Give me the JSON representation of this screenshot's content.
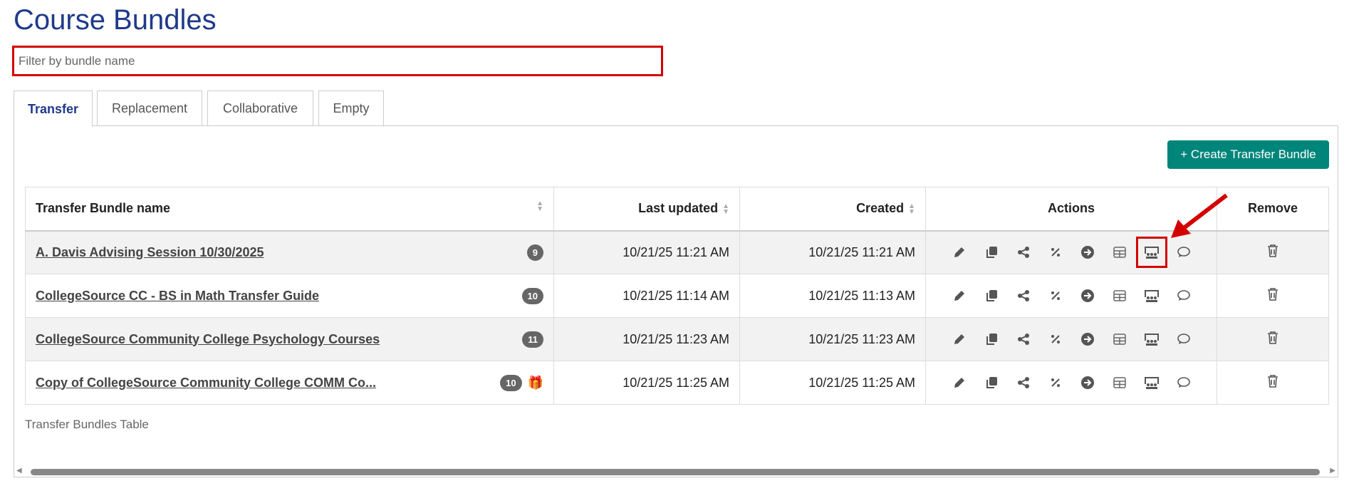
{
  "title": "Course Bundles",
  "filter": {
    "placeholder": "Filter by bundle name",
    "value": ""
  },
  "tabs": [
    {
      "label": "Transfer",
      "active": true
    },
    {
      "label": "Replacement"
    },
    {
      "label": "Collaborative"
    },
    {
      "label": "Empty"
    }
  ],
  "create_button": "+ Create Transfer Bundle",
  "table": {
    "headers": [
      "Transfer Bundle name",
      "Last updated",
      "Created",
      "Actions",
      "Remove"
    ],
    "rows": [
      {
        "name": "A. Davis Advising Session 10/30/2025",
        "count": "9",
        "updated": "10/21/25 11:21 AM",
        "created": "10/21/25 11:21 AM"
      },
      {
        "name": "CollegeSource CC - BS in Math Transfer Guide",
        "count": "10",
        "updated": "10/21/25 11:14 AM",
        "created": "10/21/25 11:13 AM"
      },
      {
        "name": "CollegeSource Community College Psychology Courses",
        "count": "11",
        "updated": "10/21/25 11:23 AM",
        "created": "10/21/25 11:23 AM"
      },
      {
        "name": "Copy of CollegeSource Community College COMM Co...",
        "count": "10",
        "updated": "10/21/25 11:25 AM",
        "created": "10/21/25 11:25 AM",
        "gift": true
      }
    ],
    "caption": "Transfer Bundles Table"
  },
  "colors": {
    "accent": "#1f3a8a",
    "button": "#00857a",
    "highlight": "#d40000"
  }
}
